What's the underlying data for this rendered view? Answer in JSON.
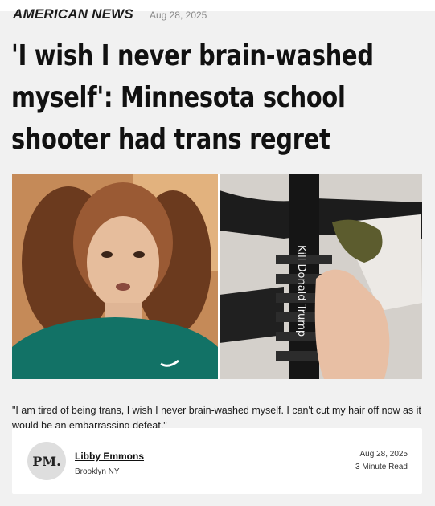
{
  "article": {
    "category": "AMERICAN NEWS",
    "date": "Aug 28, 2025",
    "headline": "'I wish I never brain-washed myself': Minnesota school shooter had trans regret",
    "caption": "\"I am tired of being trans, I wish I never brain-washed myself. I can't cut my hair off now as it would be an embarrassing defeat.\""
  },
  "hero": {
    "right_photo_text": "Kill Donald Trump"
  },
  "author": {
    "initials": "PM.",
    "name": "Libby Emmons",
    "location": "Brooklyn NY",
    "date": "Aug 28, 2025",
    "read_time": "3 Minute Read"
  }
}
